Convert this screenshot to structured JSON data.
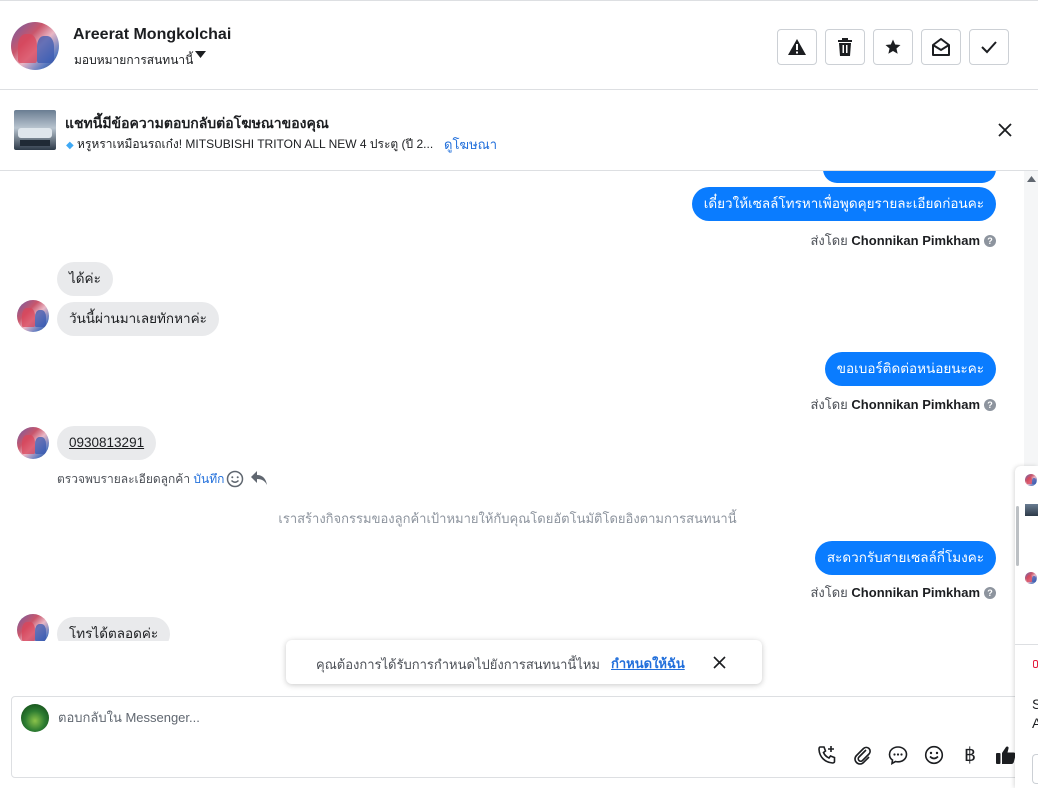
{
  "header": {
    "name": "Areerat Mongkolchai",
    "assign_label": "มอบหมายการสนทนานี้",
    "actions": [
      "spam",
      "delete",
      "star",
      "mark-unread",
      "done"
    ]
  },
  "ad_banner": {
    "title": "แชทนี้มีข้อความตอบกลับต่อโฆษณาของคุณ",
    "ad_text": "หรูหราเหมือนรถเก๋ง! MITSUBISHI TRITON ALL NEW 4 ประตู (ปี 2...",
    "view_ad_link": "ดูโฆษณา"
  },
  "messages": {
    "out_1": "เดี๋ยวให้เซลล์โทรหาเพื่อพูดคุยรายละเอียดก่อนคะ",
    "sent_by_prefix": "ส่งโดย",
    "sent_by_name": "Chonnikan Pimkham",
    "in_1": "ได้ค่ะ",
    "in_2": "วันนี้ผ่านมาเลยทักหาค่ะ",
    "out_2": "ขอเบอร์ติดต่อหน่อยนะคะ",
    "in_3": "0930813291",
    "detect_note": "ตรวจพบรายละเอียดลูกค้า",
    "detect_save": "บันทึก",
    "system_note": "เราสร้างกิจกรรมของลูกค้าเป้าหมายให้กับคุณโดยอัตโนมัติโดยอิงตามการสนทนานี้",
    "out_3": "สะดวกรับสายเซลล์กี่โมงคะ",
    "in_4": "โทรได้ตลอดค่ะ"
  },
  "toast": {
    "text": "คุณต้องการได้รับการกำหนดไปยังการสนทนานี้ไหม",
    "link": "กำหนดให้ฉัน"
  },
  "composer": {
    "placeholder": "ตอบกลับใน Messenger...",
    "icons": [
      "phone-plus-icon",
      "attachment-icon",
      "saved-reply-icon",
      "emoji-icon",
      "baht-icon",
      "thumbs-up-icon"
    ]
  },
  "right_strip": {
    "letter_1": "S",
    "letter_2": "A"
  }
}
